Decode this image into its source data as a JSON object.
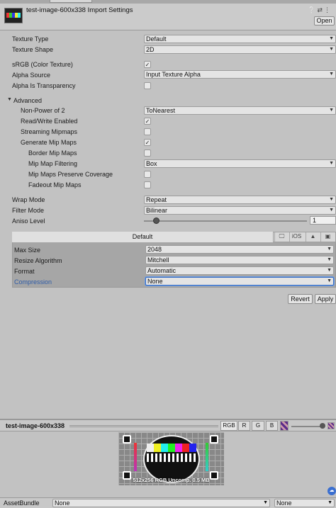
{
  "header": {
    "title": "test-image-600x338 Import Settings",
    "open_label": "Open",
    "icons": [
      "info-icon",
      "settings-icon",
      "more-icon"
    ]
  },
  "fields": {
    "texture_type": {
      "label": "Texture Type",
      "value": "Default"
    },
    "texture_shape": {
      "label": "Texture Shape",
      "value": "2D"
    },
    "srgb": {
      "label": "sRGB (Color Texture)",
      "checked": true
    },
    "alpha_source": {
      "label": "Alpha Source",
      "value": "Input Texture Alpha"
    },
    "alpha_transparency": {
      "label": "Alpha Is Transparency",
      "checked": false
    },
    "advanced": {
      "label": "Advanced",
      "expanded": true
    },
    "npot": {
      "label": "Non-Power of 2",
      "value": "ToNearest"
    },
    "read_write": {
      "label": "Read/Write Enabled",
      "checked": true
    },
    "streaming_mipmaps": {
      "label": "Streaming Mipmaps",
      "checked": false
    },
    "generate_mips": {
      "label": "Generate Mip Maps",
      "checked": true
    },
    "border_mips": {
      "label": "Border Mip Maps",
      "checked": false
    },
    "mip_filtering": {
      "label": "Mip Map Filtering",
      "value": "Box"
    },
    "mip_coverage": {
      "label": "Mip Maps Preserve Coverage",
      "checked": false
    },
    "fadeout_mips": {
      "label": "Fadeout Mip Maps",
      "checked": false
    },
    "wrap_mode": {
      "label": "Wrap Mode",
      "value": "Repeat"
    },
    "filter_mode": {
      "label": "Filter Mode",
      "value": "Bilinear"
    },
    "aniso_level": {
      "label": "Aniso Level",
      "value": "1"
    }
  },
  "platform": {
    "default_tab": "Default",
    "ios_tab": "iOS",
    "max_size": {
      "label": "Max Size",
      "value": "2048"
    },
    "resize_algorithm": {
      "label": "Resize Algorithm",
      "value": "Mitchell"
    },
    "format": {
      "label": "Format",
      "value": "Automatic"
    },
    "compression": {
      "label": "Compression",
      "value": "None"
    }
  },
  "actions": {
    "revert": "Revert",
    "apply": "Apply"
  },
  "preview": {
    "name": "test-image-600x338",
    "channels": [
      "RGB",
      "R",
      "G",
      "B"
    ],
    "info": "512x256  RGB  Uncomp.  0.5 MB"
  },
  "asset_bundle": {
    "label": "AssetBundle",
    "value1": "None",
    "value2": "None"
  },
  "colors": {
    "accent": "#2f5ca8",
    "panel": "#c2c2c2"
  }
}
